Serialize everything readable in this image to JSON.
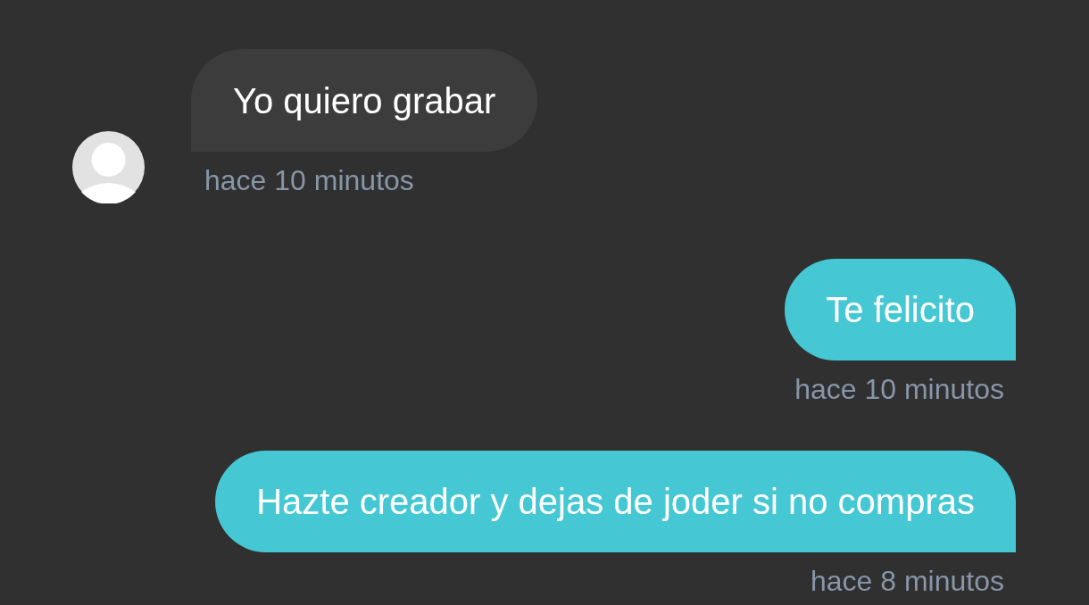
{
  "messages": [
    {
      "kind": "incoming",
      "text": "Yo quiero grabar",
      "time": "hace 10 minutos"
    },
    {
      "kind": "outgoing",
      "text": "Te felicito",
      "time": "hace 10 minutos"
    },
    {
      "kind": "outgoing",
      "text": "Hazte creador y dejas de joder si no compras",
      "time": "hace 8 minutos"
    }
  ]
}
